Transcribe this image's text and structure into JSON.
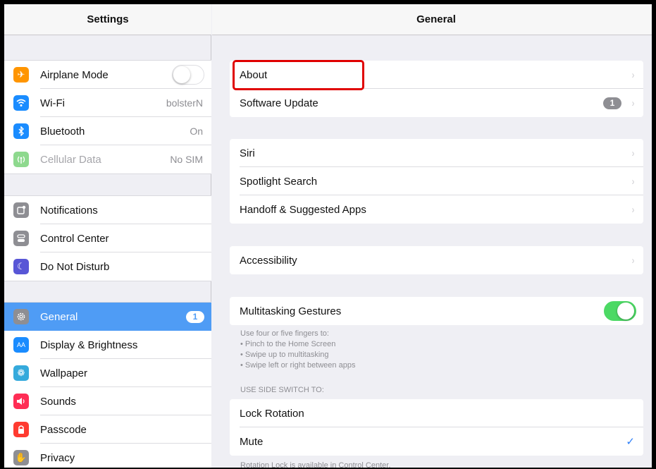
{
  "left": {
    "title": "Settings",
    "group1": [
      {
        "label": "Airplane Mode",
        "icon": "airplane-icon",
        "color": "#ff9500",
        "toggle": false
      },
      {
        "label": "Wi-Fi",
        "icon": "wifi-icon",
        "color": "#1a8cff",
        "value": "bolsterN"
      },
      {
        "label": "Bluetooth",
        "icon": "bluetooth-icon",
        "color": "#1a8cff",
        "value": "On"
      },
      {
        "label": "Cellular Data",
        "icon": "cellular-icon",
        "color": "#8ed98e",
        "value": "No SIM"
      }
    ],
    "group2": [
      {
        "label": "Notifications",
        "icon": "notifications-icon",
        "color": "#8e8e93"
      },
      {
        "label": "Control Center",
        "icon": "control-center-icon",
        "color": "#8e8e93"
      },
      {
        "label": "Do Not Disturb",
        "icon": "moon-icon",
        "color": "#5856d6"
      }
    ],
    "group3": [
      {
        "label": "General",
        "icon": "gear-icon",
        "color": "#8e8e93",
        "badge": "1"
      },
      {
        "label": "Display & Brightness",
        "icon": "display-icon",
        "color": "#1a8cff",
        "glyph": "AA"
      },
      {
        "label": "Wallpaper",
        "icon": "wallpaper-icon",
        "color": "#35aadc"
      },
      {
        "label": "Sounds",
        "icon": "speaker-icon",
        "color": "#ff2d55"
      },
      {
        "label": "Passcode",
        "icon": "lock-icon",
        "color": "#ff3b30"
      },
      {
        "label": "Privacy",
        "icon": "hand-icon",
        "color": "#8e8e93"
      }
    ]
  },
  "right": {
    "title": "General",
    "group1": [
      {
        "label": "About"
      },
      {
        "label": "Software Update",
        "badge": "1"
      }
    ],
    "group2": [
      {
        "label": "Siri"
      },
      {
        "label": "Spotlight Search"
      },
      {
        "label": "Handoff & Suggested Apps"
      }
    ],
    "group3": [
      {
        "label": "Accessibility"
      }
    ],
    "multitasking": {
      "label": "Multitasking Gestures",
      "toggle": true
    },
    "multitasking_note": [
      "Use four or five fingers to:",
      "• Pinch to the Home Screen",
      "• Swipe up to multitasking",
      "• Swipe left or right between apps"
    ],
    "side_switch_header": "USE SIDE SWITCH TO:",
    "side_switch": [
      {
        "label": "Lock Rotation",
        "checked": false
      },
      {
        "label": "Mute",
        "checked": true
      }
    ],
    "rotation_note": "Rotation Lock is available in Control Center."
  },
  "glyphs": {
    "chevron": "›",
    "check": "✓"
  },
  "colors": {
    "accent": "#4f9cf5",
    "toggle_on": "#4cd964",
    "highlight": "#e00000"
  }
}
